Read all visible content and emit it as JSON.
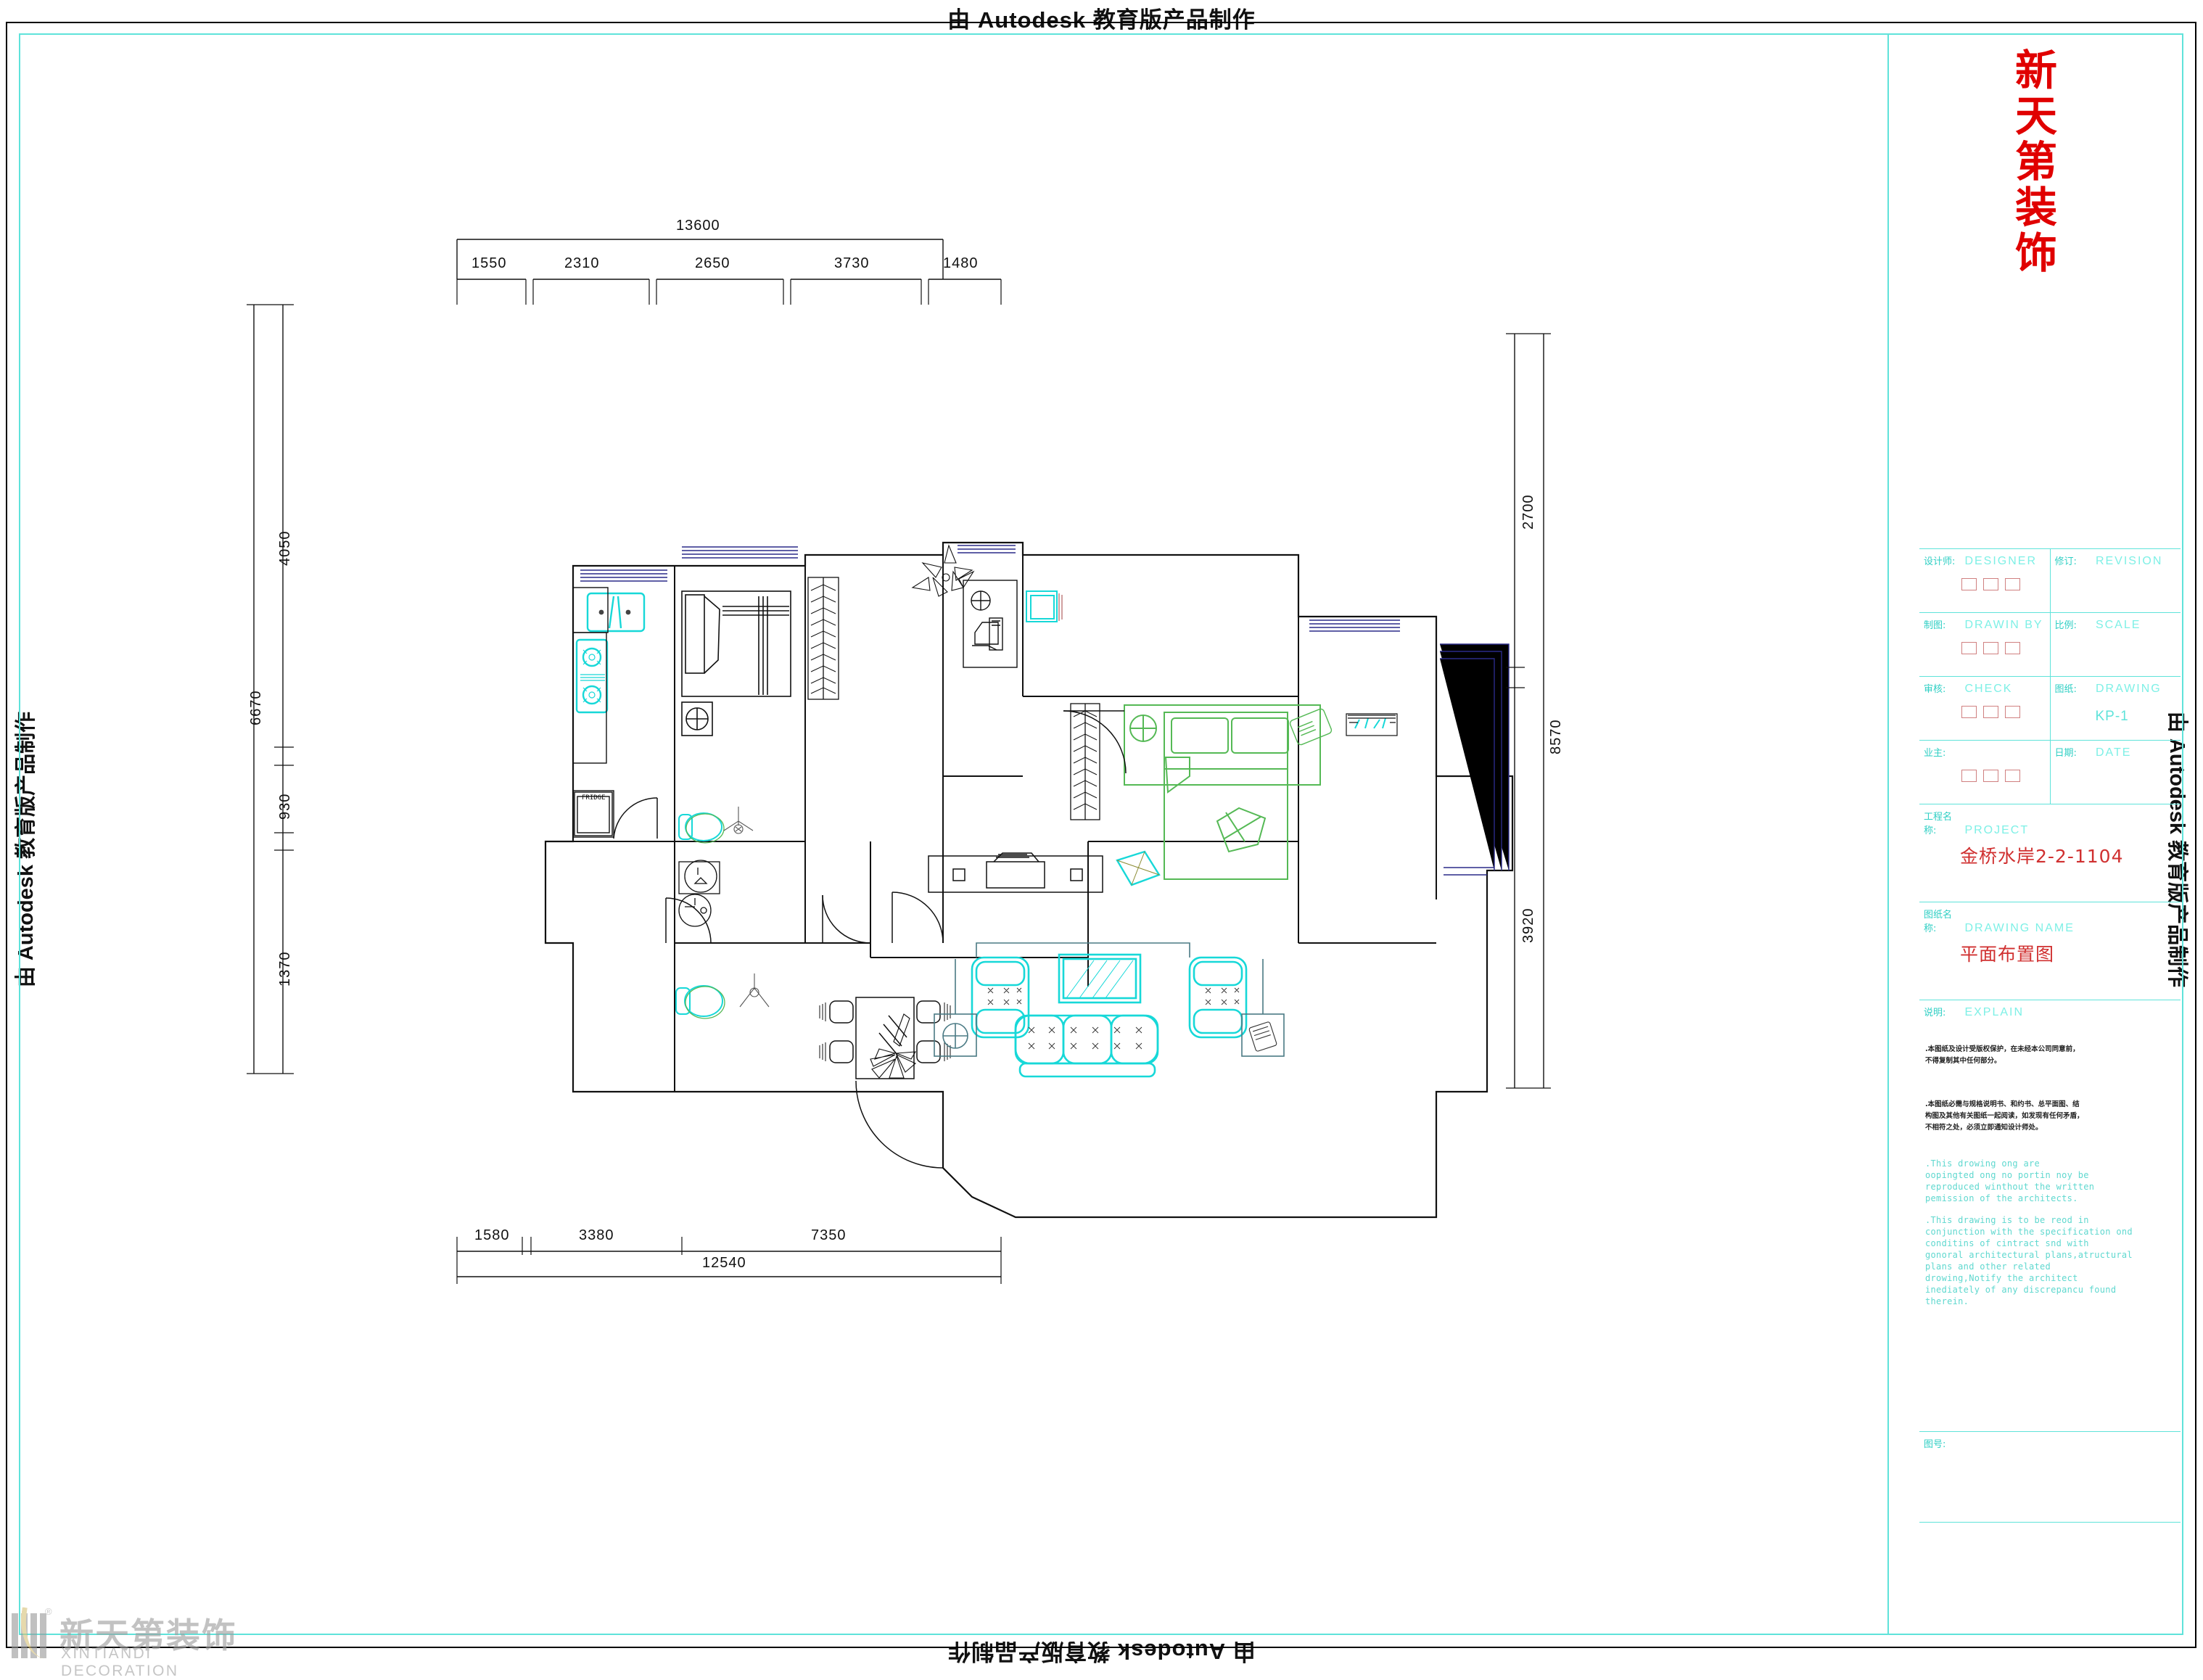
{
  "watermark": {
    "autodesk": "由 Autodesk 教育版产品制作"
  },
  "brand": {
    "cn": "新天第装饰",
    "en": "XINTIANDI DECORATION",
    "registered": "®"
  },
  "titleblock": {
    "logo_chars": [
      "新",
      "天",
      "第",
      "装",
      "饰"
    ],
    "rows": [
      {
        "cn": "设计师:",
        "en": "DESIGNER",
        "cn2": "修订:",
        "en2": "REVISION",
        "boxes": 3,
        "boxes2": 0
      },
      {
        "cn": "制图:",
        "en": "DRAWIN BY",
        "cn2": "比例:",
        "en2": "SCALE",
        "boxes": 3,
        "boxes2": 0
      },
      {
        "cn": "审核:",
        "en": "CHECK",
        "cn2": "图纸:",
        "en2": "DRAWING",
        "boxes": 3,
        "value2": "KP-1"
      },
      {
        "cn": "业主:",
        "en": "",
        "cn2": "日期:",
        "en2": "DATE",
        "boxes": 3,
        "boxes2": 0
      }
    ],
    "project": {
      "cn": "工程名称:",
      "en": "PROJECT",
      "value": "金桥水岸2-2-1104"
    },
    "drawing": {
      "cn": "图纸名称:",
      "en": "DRAWING NAME",
      "value": "平面布置图"
    },
    "explain": {
      "cn": "说明:",
      "en": "EXPLAIN",
      "notes_cn": [
        ".本图纸及设计受版权保护，在未经本公司同意前，",
        "  不得复制其中任何部分。",
        ".本图纸必需与规格说明书、和约书、总平面图、结",
        "  构图及其他有关图纸一起阅读，如发现有任何矛盾，",
        "  不相符之处，必须立即通知设计师处。"
      ],
      "notes_en": [
        ".This drowing ong are",
        " oopingted ong no portin noy be",
        " reproduced winthout the written",
        " pemission of the architects.",
        ".This drawing is to be reod in",
        " conjunction with the specification ond",
        " conditins of cintract snd with",
        " gonoral architectural plans,atructural",
        " plans and other related",
        " drowing,Notify the architect",
        " inediately of any discrepancu found",
        " therein."
      ]
    },
    "drawing_no": {
      "cn": "图号:"
    }
  },
  "plan": {
    "dimensions": {
      "top_total": "13600",
      "top_segments": [
        "1550",
        "2310",
        "2650",
        "3730",
        "1480"
      ],
      "bottom_total": "12540",
      "bottom_segments": [
        "1580",
        "3380",
        "7350"
      ],
      "left_total": "6670",
      "left_segments": [
        "4050",
        "930",
        "1370"
      ],
      "right_total": "8570",
      "right_segments": [
        "2700",
        "3920"
      ]
    },
    "labels": {
      "fridge": "FRIDGE"
    },
    "colors": {
      "wall": "#111111",
      "furniture_cyan": "#17d8d8",
      "furniture_green": "#55b955",
      "window_blue": "#2a2a88",
      "frame_cyan": "#5fe3da",
      "brand_red": "#e00000"
    }
  }
}
